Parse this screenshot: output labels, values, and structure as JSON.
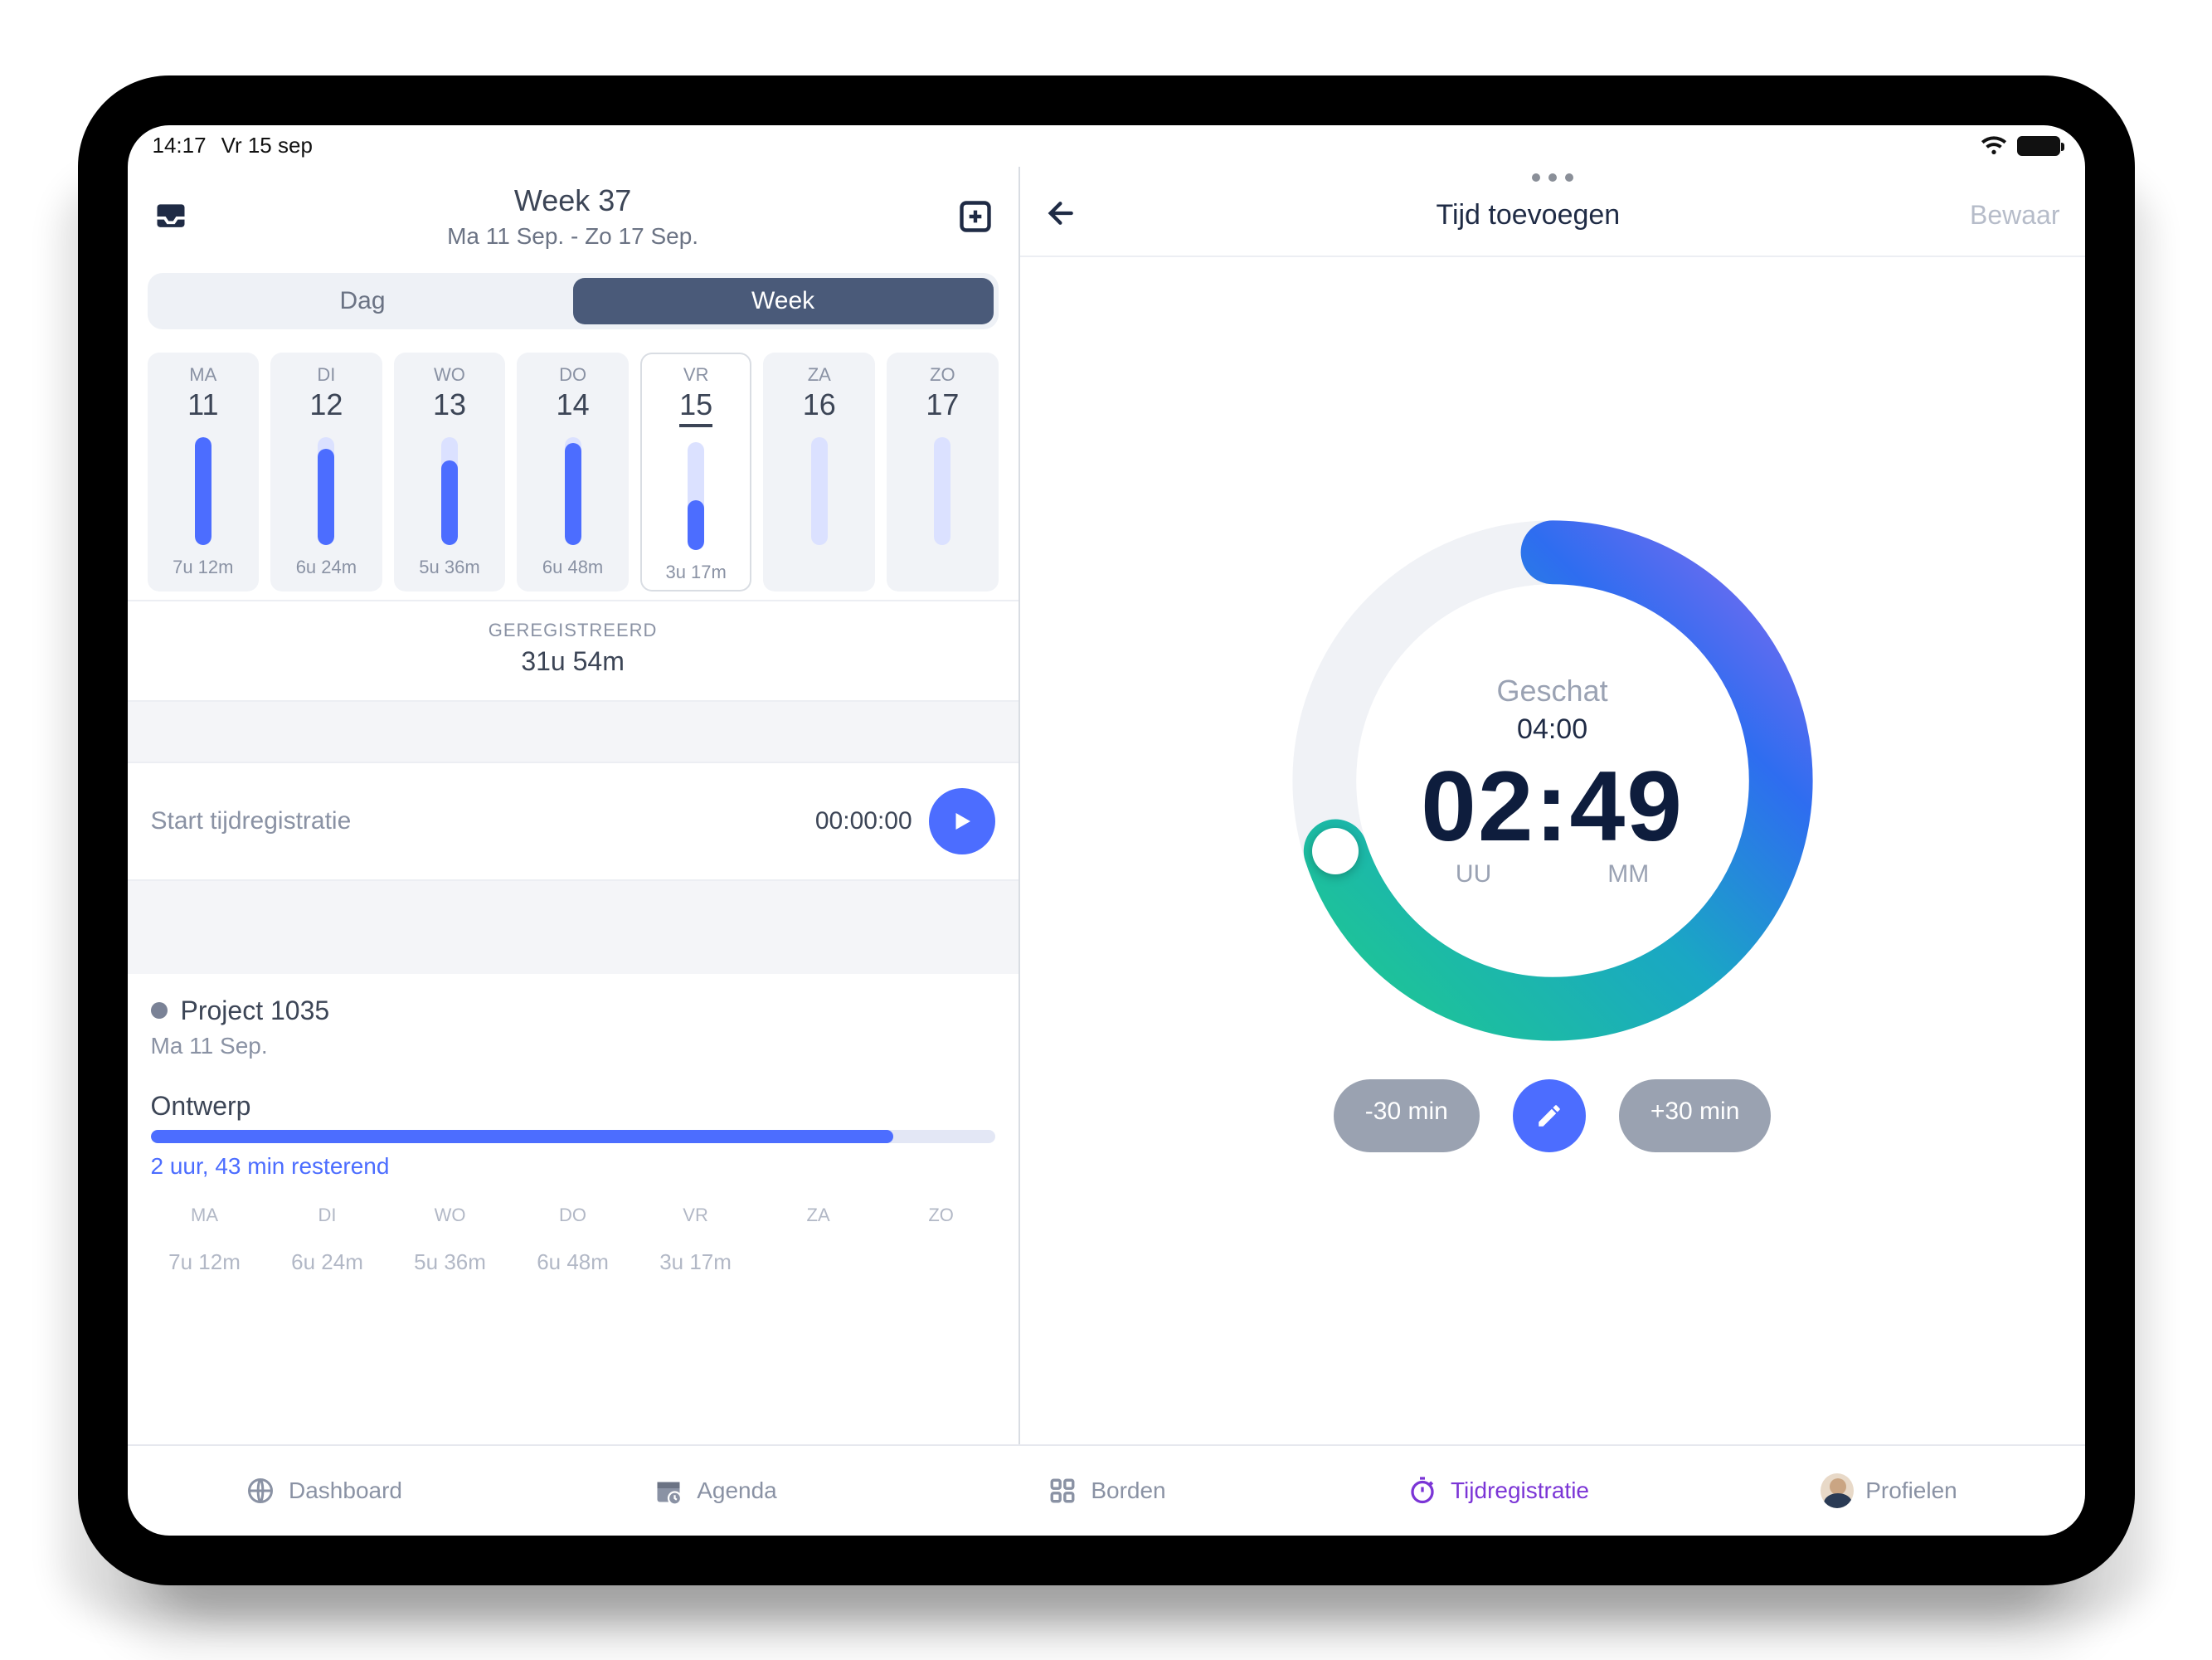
{
  "status": {
    "time": "14:17",
    "date": "Vr 15 sep"
  },
  "left": {
    "week_title": "Week 37",
    "week_range": "Ma 11 Sep. - Zo 17 Sep.",
    "segments": {
      "day": "Dag",
      "week": "Week"
    },
    "days": [
      {
        "abbr": "MA",
        "num": "11",
        "time": "7u 12m",
        "fill": 100
      },
      {
        "abbr": "DI",
        "num": "12",
        "time": "6u 24m",
        "fill": 89
      },
      {
        "abbr": "WO",
        "num": "13",
        "time": "5u 36m",
        "fill": 78
      },
      {
        "abbr": "DO",
        "num": "14",
        "time": "6u 48m",
        "fill": 94
      },
      {
        "abbr": "VR",
        "num": "15",
        "time": "3u 17m",
        "fill": 46,
        "selected": true
      },
      {
        "abbr": "ZA",
        "num": "16",
        "time": "",
        "fill": 0
      },
      {
        "abbr": "ZO",
        "num": "17",
        "time": "",
        "fill": 0
      }
    ],
    "registered_label": "GEREGISTREERD",
    "registered_value": "31u 54m",
    "start_label": "Start tijdregistratie",
    "start_time": "00:00:00",
    "project": {
      "name": "Project 1035",
      "date": "Ma 11 Sep.",
      "task": "Ontwerp",
      "progress_pct": 88,
      "remaining": "2 uur, 43 min resterend"
    },
    "mini_days": [
      {
        "abbr": "MA",
        "time": "7u 12m"
      },
      {
        "abbr": "DI",
        "time": "6u 24m"
      },
      {
        "abbr": "WO",
        "time": "5u 36m"
      },
      {
        "abbr": "DO",
        "time": "6u 48m"
      },
      {
        "abbr": "VR",
        "time": "3u 17m"
      },
      {
        "abbr": "ZA",
        "time": ""
      },
      {
        "abbr": "ZO",
        "time": ""
      }
    ]
  },
  "right": {
    "title": "Tijd toevoegen",
    "save": "Bewaar",
    "estimate_label": "Geschat",
    "estimate_value": "04:00",
    "time_value": "02:49",
    "unit_h": "UU",
    "unit_m": "MM",
    "minus30": "-30 min",
    "plus30": "+30 min",
    "dial_fraction": 0.7
  },
  "tabs": {
    "dashboard": "Dashboard",
    "agenda": "Agenda",
    "boards": "Borden",
    "time": "Tijdregistratie",
    "profiles": "Profielen"
  }
}
